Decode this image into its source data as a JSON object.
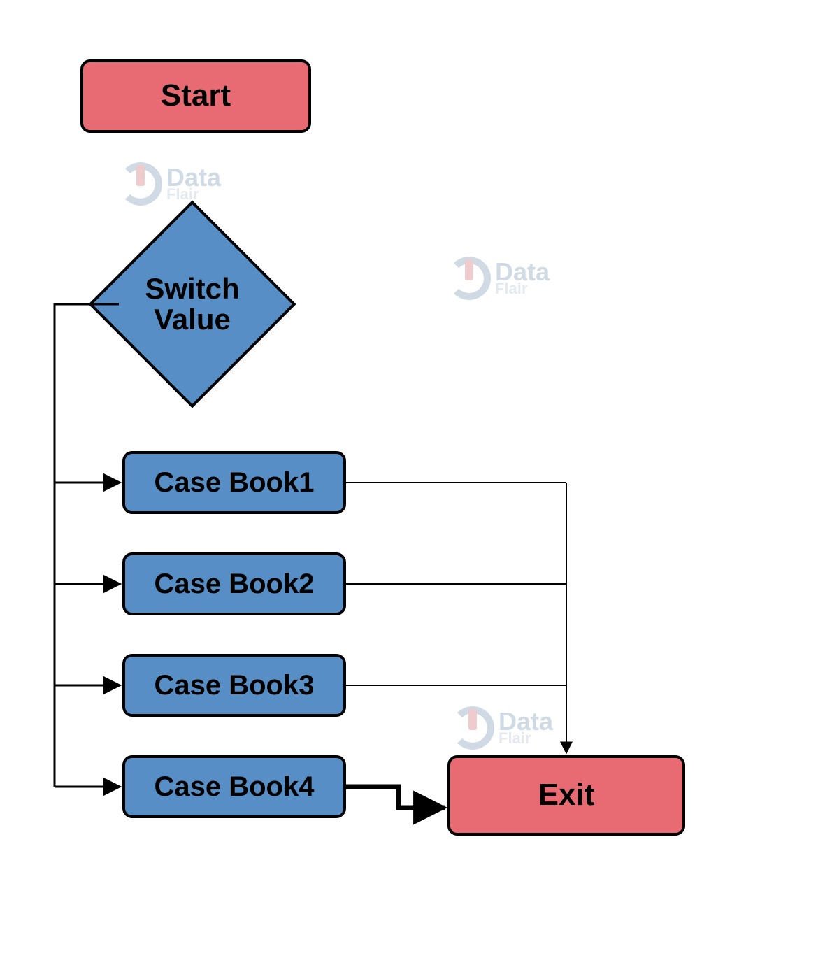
{
  "nodes": {
    "start": "Start",
    "decision": "Switch\nValue",
    "case1": "Case Book1",
    "case2": "Case Book2",
    "case3": "Case Book3",
    "case4": "Case Book4",
    "exit": "Exit"
  },
  "watermark": {
    "line1": "Data",
    "line2": "Flair"
  },
  "colors": {
    "red": "#e86a72",
    "blue": "#578ec5",
    "stroke": "#000000"
  }
}
